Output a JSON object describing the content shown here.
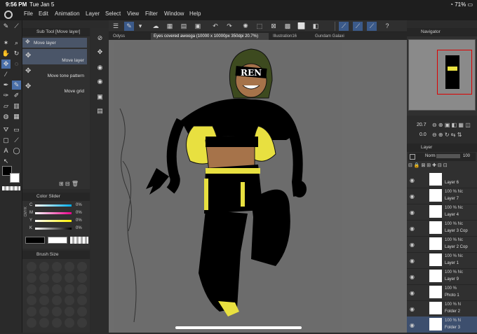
{
  "status": {
    "time": "9:56 PM",
    "date": "Tue Jan 5",
    "battery": "71%"
  },
  "menu": [
    "File",
    "Edit",
    "Animation",
    "Layer",
    "Select",
    "View",
    "Filter",
    "Window",
    "Help"
  ],
  "tabs": [
    "Odyss",
    "Eyes covered awooga (10000 x 10000px 350dpi 20.7%)",
    "Illustration16",
    "Gundam Galaxi"
  ],
  "subtool": {
    "header": "Sub Tool [Move layer]",
    "items": [
      "Move layer",
      "Move layer",
      "Move tone pattern",
      "Move grid"
    ]
  },
  "color_slider": {
    "header": "Color Slider",
    "mode": "CMYK",
    "channels": [
      {
        "label": "C",
        "value": "0%"
      },
      {
        "label": "M",
        "value": "0%"
      },
      {
        "label": "Y",
        "value": "0%"
      },
      {
        "label": "K",
        "value": "0%"
      }
    ]
  },
  "brush": {
    "header": "Brush Size"
  },
  "navigator": {
    "header": "Navigator",
    "zoom": "20.7",
    "rotation": "0.0"
  },
  "layer_panel": {
    "header": "Layer",
    "blend": "Norm",
    "opacity": "100",
    "layers": [
      {
        "pct": "",
        "name": "Layer 6"
      },
      {
        "pct": "100 % Nc",
        "name": "Layer 7"
      },
      {
        "pct": "100 % Nc",
        "name": "Layer 4"
      },
      {
        "pct": "100 % Nc",
        "name": "Layer 3 Cop"
      },
      {
        "pct": "100 % Nc",
        "name": "Layer 2 Cop"
      },
      {
        "pct": "100 % Nc",
        "name": "Layer 1"
      },
      {
        "pct": "100 % Nc",
        "name": "Layer 9"
      },
      {
        "pct": "100 %",
        "name": "Photo 1"
      },
      {
        "pct": "100 % N",
        "name": "Folder 2"
      },
      {
        "pct": "100 % N",
        "name": "Folder 3"
      }
    ]
  },
  "canvas_text": "REN"
}
